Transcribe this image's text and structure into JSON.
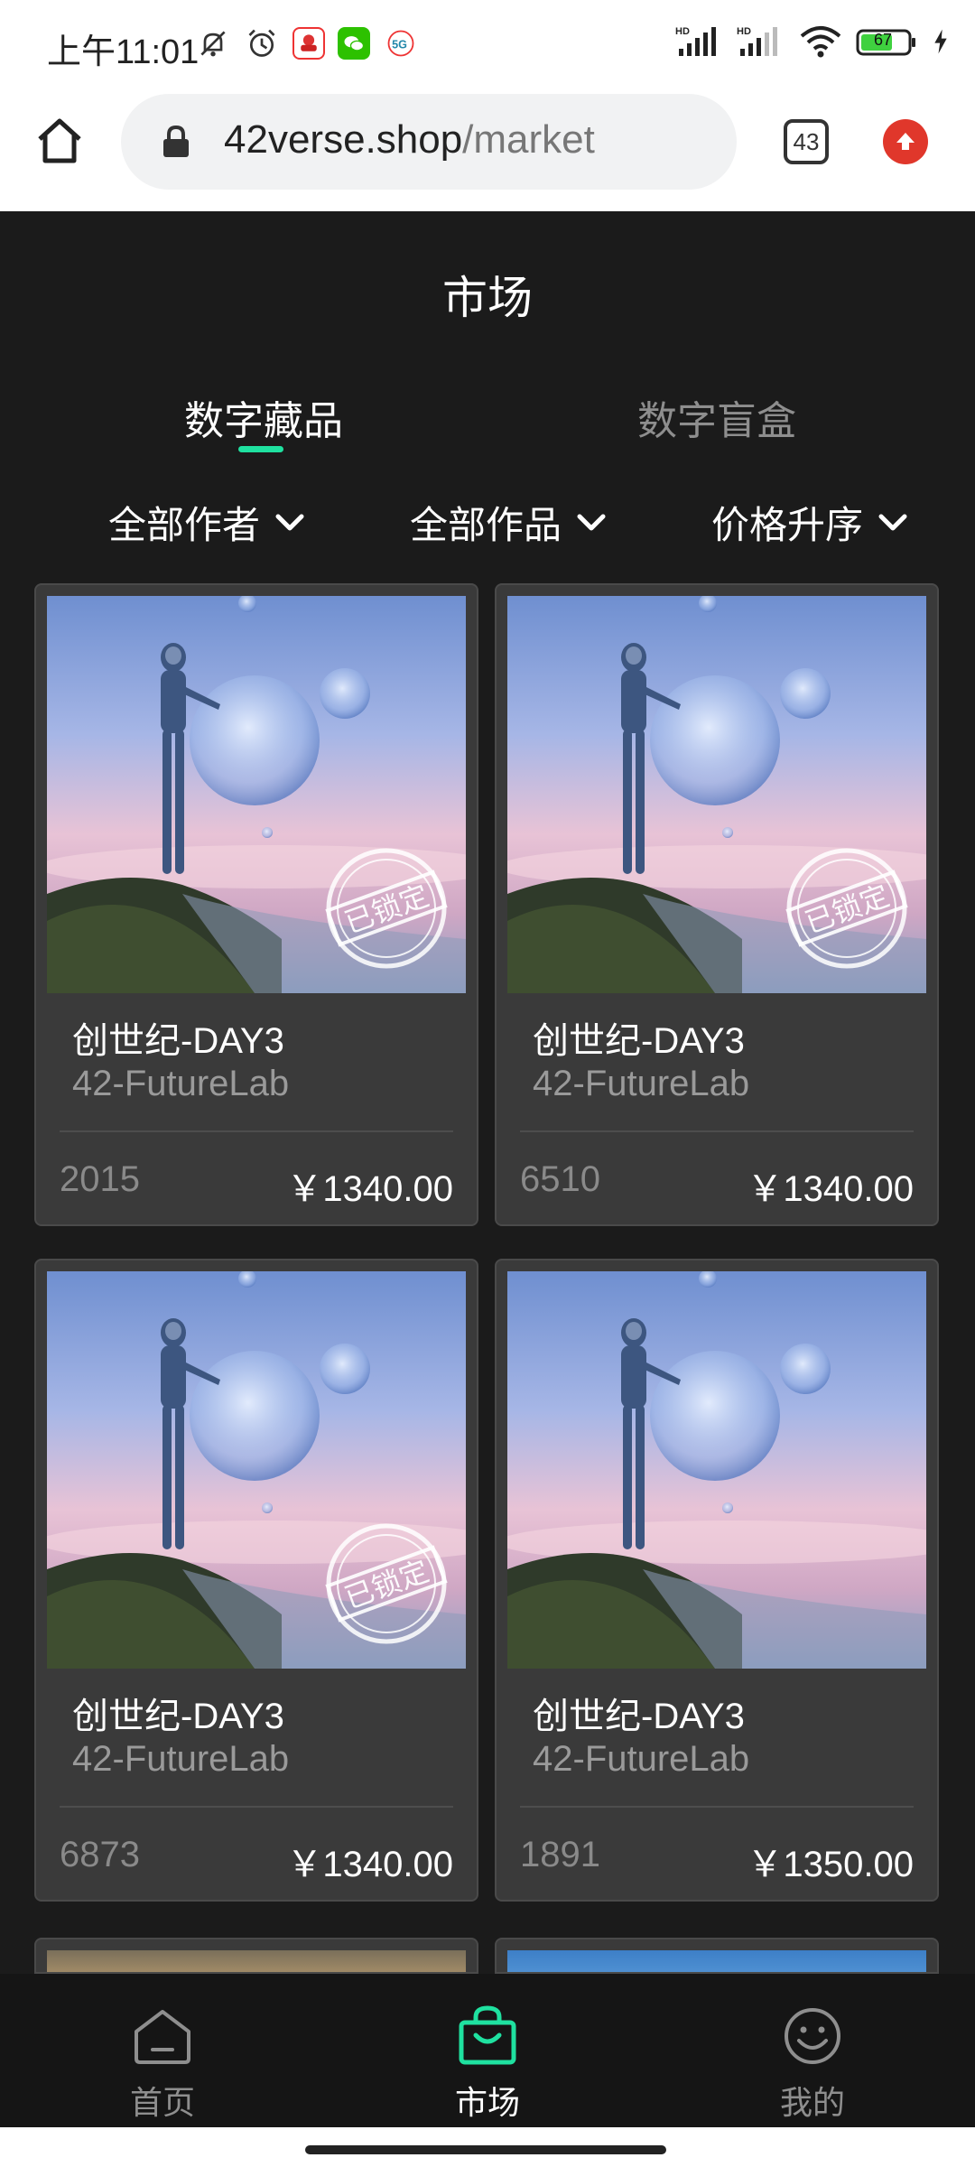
{
  "status_bar": {
    "time": "上午11:01",
    "network_label_1": "HD",
    "network_label_2": "HD",
    "battery": "67",
    "icons_left": [
      "mute-icon",
      "alarm-icon",
      "app-icon",
      "wechat-icon",
      "5g-icon"
    ],
    "icons_right": [
      "signal-icon",
      "signal-icon",
      "wifi-icon",
      "battery-icon",
      "charging-icon"
    ]
  },
  "browser": {
    "url_host": "42verse.shop",
    "url_path": "/market",
    "tab_count": "43"
  },
  "page": {
    "title": "市场",
    "tabs": [
      {
        "label": "数字藏品",
        "active": true
      },
      {
        "label": "数字盲盒",
        "active": false
      }
    ],
    "filters": [
      {
        "label": "全部作者"
      },
      {
        "label": "全部作品"
      },
      {
        "label": "价格升序"
      }
    ]
  },
  "cards": [
    {
      "title": "创世纪-DAY3",
      "author": "42-FutureLab",
      "serial": "2015",
      "price": "￥1340.00",
      "stamp": "已锁定",
      "locked": true
    },
    {
      "title": "创世纪-DAY3",
      "author": "42-FutureLab",
      "serial": "6510",
      "price": "￥1340.00",
      "stamp": "已锁定",
      "locked": true
    },
    {
      "title": "创世纪-DAY3",
      "author": "42-FutureLab",
      "serial": "6873",
      "price": "￥1340.00",
      "stamp": "已锁定",
      "locked": true
    },
    {
      "title": "创世纪-DAY3",
      "author": "42-FutureLab",
      "serial": "1891",
      "price": "￥1350.00",
      "stamp": "",
      "locked": false
    }
  ],
  "bottom_nav": [
    {
      "label": "首页",
      "icon": "home-icon",
      "active": false
    },
    {
      "label": "市场",
      "icon": "shopping-bag-icon",
      "active": true
    },
    {
      "label": "我的",
      "icon": "smiley-icon",
      "active": false
    }
  ],
  "colors": {
    "accent": "#1fe1a0",
    "background": "#1b1b1b",
    "card": "#3a3a3a"
  }
}
